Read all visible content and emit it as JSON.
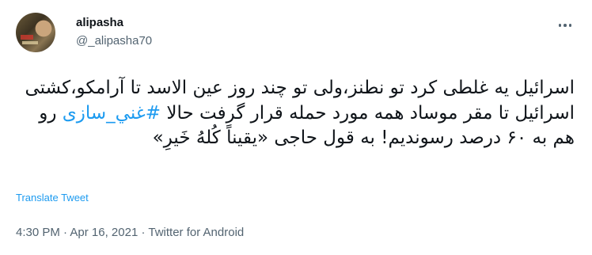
{
  "user": {
    "name": "alipasha",
    "handle": "@_alipasha70"
  },
  "tweet": {
    "text_before": "اسرائیل یه غلطی کرد تو نطنز،ولی تو چند روز عین الاسد تا آرامکو،کشتی اسرائیل تا مقر موساد همه مورد حمله قرار گرفت حالا ",
    "hashtag": "#غني_سازی",
    "text_after": " رو هم به ۶۰ درصد رسوندیم! به قول حاجی «یقیناً کُلهُ خَیرِ»"
  },
  "translate_label": "Translate Tweet",
  "meta": {
    "time": "4:30 PM",
    "separator1": " · ",
    "date": "Apr 16, 2021",
    "separator2": " · ",
    "source": "Twitter for Android"
  },
  "icons": {
    "more": "more-horizontal-icon"
  },
  "colors": {
    "accent": "#1d9bf0",
    "text": "#0f1419",
    "secondary": "#536471"
  }
}
